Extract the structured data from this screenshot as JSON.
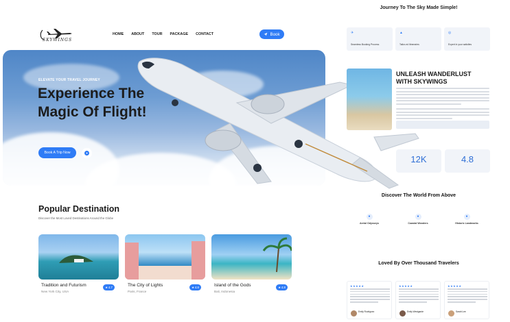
{
  "nav": {
    "logo_text": "SKYWINGS",
    "links": [
      "HOME",
      "ABOUT",
      "TOUR",
      "PACKAGE",
      "CONTACT"
    ],
    "book_label": "Book"
  },
  "hero": {
    "kicker": "ELEVATE YOUR TRAVEL JOURNEY",
    "title": "Experience The Magic Of Flight!",
    "cta": "Book A Trip Now"
  },
  "popular": {
    "title": "Popular Destination",
    "subtitle": "Discover the Most Loved Destinations Around the Globe",
    "cards": [
      {
        "name": "Tradition and Futurism",
        "location": "New York City, USA",
        "rating": "4.7"
      },
      {
        "name": "The City of Lights",
        "location": "Paris, France",
        "rating": "4.8"
      },
      {
        "name": "Island of the Gods",
        "location": "Bali, Indonesia",
        "rating": "4.8"
      }
    ]
  },
  "side": {
    "journey_title": "Journey To The Sky Made Simple!",
    "features": [
      "Seamless Booking Process",
      "Tailor-ed Itineraries",
      "Expert in your satisfies"
    ],
    "about_heading": "UNLEASH WANDERLUST WITH SKYWINGS",
    "stats": [
      {
        "value": "12K"
      },
      {
        "value": "4.8"
      }
    ],
    "discover_title": "Discover The World From Above",
    "discover_items": [
      "Aerial Odysseys",
      "Coastal Wonders",
      "Historic Landmarks"
    ],
    "loved_title": "Loved By Over Thousand Travelers",
    "testimonials": [
      "Emily Rodriguez",
      "Emily Westgarde",
      "Sarah Lee"
    ]
  }
}
